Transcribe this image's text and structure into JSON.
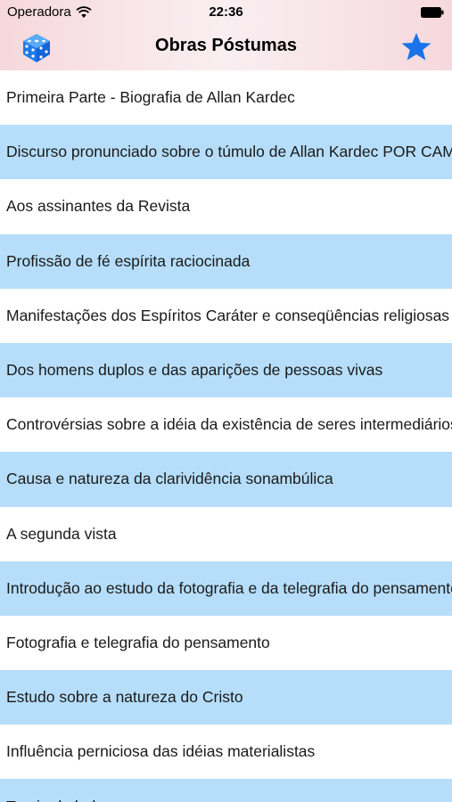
{
  "status_bar": {
    "carrier": "Operadora",
    "time": "22:36"
  },
  "nav": {
    "title": "Obras Póstumas",
    "left_icon": "dice-icon",
    "right_icon": "star-icon",
    "accent_color": "#1a73e8"
  },
  "colors": {
    "row_alt": "#b6defa",
    "row": "#ffffff"
  },
  "items": [
    {
      "label": "Primeira Parte - Biografia de Allan Kardec"
    },
    {
      "label": "Discurso pronunciado sobre o túmulo de Allan Kardec POR CAMILLE FLAMMARION"
    },
    {
      "label": "Aos assinantes da Revista"
    },
    {
      "label": "Profissão de fé espírita raciocinada"
    },
    {
      "label": "Manifestações dos Espíritos Caráter e conseqüências religiosas"
    },
    {
      "label": "Dos homens duplos e das aparições de pessoas vivas"
    },
    {
      "label": "Controvérsias sobre a idéia da existência de seres intermediários"
    },
    {
      "label": "Causa e natureza da clarividência sonambúlica"
    },
    {
      "label": "A segunda vista"
    },
    {
      "label": "Introdução ao estudo da fotografia e da telegrafia do pensamento"
    },
    {
      "label": "Fotografia e telegrafia do pensamento"
    },
    {
      "label": "Estudo sobre a natureza do Cristo"
    },
    {
      "label": "Influência perniciosa das idéias materialistas"
    },
    {
      "label": "Teoria da beleza"
    }
  ]
}
